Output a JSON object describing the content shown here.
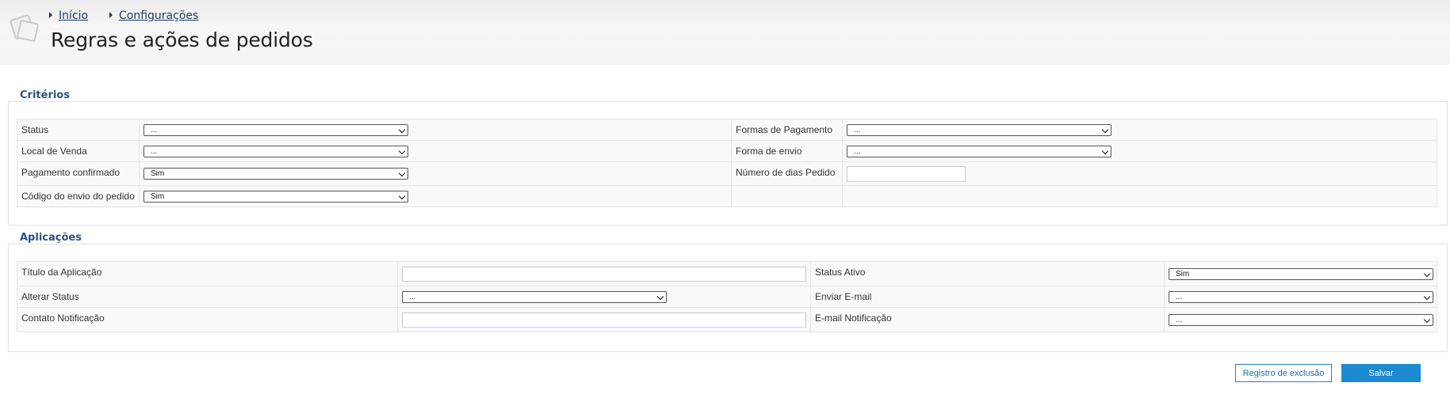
{
  "header": {
    "breadcrumb": [
      {
        "label": "Início"
      },
      {
        "label": "Configurações"
      }
    ],
    "title": "Regras e ações de pedidos"
  },
  "criteria": {
    "legend": "Critérios",
    "status": {
      "label": "Status",
      "value": "..."
    },
    "payment_forms": {
      "label": "Formas de Pagamento",
      "value": "..."
    },
    "sale_location": {
      "label": "Local de Venda",
      "value": "..."
    },
    "shipping_form": {
      "label": "Forma de envio",
      "value": "..."
    },
    "payment_confirmed": {
      "label": "Pagamento confirmado",
      "value": "Sim"
    },
    "order_days": {
      "label": "Número de dias Pedido",
      "value": ""
    },
    "shipping_code": {
      "label": "Código do envio do pedido",
      "value": "Sim"
    }
  },
  "applications": {
    "legend": "Aplicações",
    "app_title": {
      "label": "Título da Aplicação",
      "value": ""
    },
    "active_status": {
      "label": "Status Ativo",
      "value": "Sim"
    },
    "change_status": {
      "label": "Alterar Status",
      "value": "..."
    },
    "send_email": {
      "label": "Enviar E-mail",
      "value": "..."
    },
    "notification_contact": {
      "label": "Contato Notificação",
      "value": ""
    },
    "notification_email": {
      "label": "E-mail Notificação",
      "value": "..."
    }
  },
  "actions": {
    "exclusion_log_label": "Registro de exclusão",
    "save_label": "Salvar"
  },
  "colors": {
    "accent": "#1b8ad1",
    "legend": "#2a5283",
    "link": "#1f3d6b"
  }
}
